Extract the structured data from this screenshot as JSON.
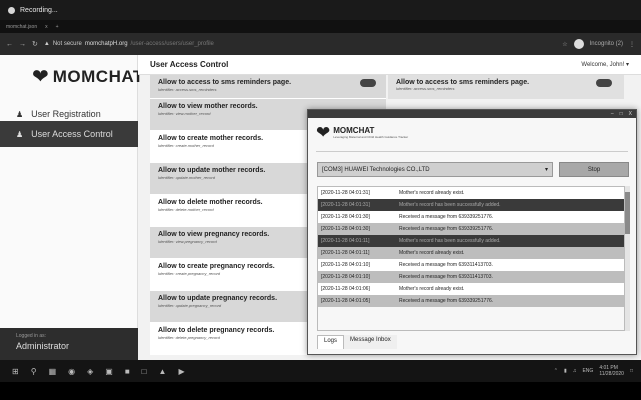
{
  "recording": {
    "label": "Recording..."
  },
  "browser": {
    "tab_labels": [
      "momchat.json",
      "x",
      "+"
    ],
    "security": "Not secure",
    "host": "momchatpH.org",
    "path": "/user-access/users/user_profile",
    "profile": "Incognito (2)"
  },
  "app": {
    "brand": "MOMCHAT",
    "sidebar": {
      "items": [
        {
          "label": "User Registration",
          "icon": "user-icon"
        },
        {
          "label": "User Access Control",
          "icon": "users-icon"
        }
      ],
      "footer_small": "Logged in as:",
      "footer_user": "Administrator"
    },
    "header": {
      "title": "User Access Control",
      "welcome": "Welcome, John! ▾"
    },
    "permissions": [
      {
        "label": "Allow to access to sms reminders page.",
        "ident": "Identifier: access.sms_reminders"
      },
      {
        "label": "Allow to view mother records.",
        "ident": "Identifier: view.mother_record"
      },
      {
        "label": "Allow to create mother records.",
        "ident": "Identifier: create.mother_record"
      },
      {
        "label": "Allow to update mother records.",
        "ident": "Identifier: update.mother_record"
      },
      {
        "label": "Allow to delete mother records.",
        "ident": "Identifier: delete.mother_record"
      },
      {
        "label": "Allow to view pregnancy records.",
        "ident": "Identifier: view.pregnancy_record"
      },
      {
        "label": "Allow to create pregnancy records.",
        "ident": "Identifier: create.pregnancy_record"
      },
      {
        "label": "Allow to update pregnancy records.",
        "ident": "Identifier: update.pregnancy_record"
      },
      {
        "label": "Allow to delete pregnancy records.",
        "ident": "Identifier: delete.pregnancy_record"
      }
    ],
    "permission_right": {
      "label": "Allow to access to sms reminders page.",
      "ident": "Identifier: access.sms_reminders"
    }
  },
  "dialog": {
    "titlebar_controls": [
      "–",
      "□",
      "X"
    ],
    "brand": "MOMCHAT",
    "tagline": "Leveraging Maternal and Child Health Guidance Tracker",
    "port": "[COM3] HUAWEI Technologies CO.,LTD",
    "stop_label": "Stop",
    "logs": [
      {
        "ts": "[2020-11-28 04:01:31]",
        "msg": "Mother's record already exist.",
        "style": "white"
      },
      {
        "ts": "[2020-11-28 04:01:31]",
        "msg": "Mother's record has been successfully added.",
        "style": "dark"
      },
      {
        "ts": "[2020-11-28 04:01:30]",
        "msg": "Received a message from 639339251776.",
        "style": "white"
      },
      {
        "ts": "[2020-11-28 04:01:30]",
        "msg": "Received a message from 639339251776.",
        "style": "gray"
      },
      {
        "ts": "[2020-11-28 04:01:11]",
        "msg": "Mother's record has been successfully added.",
        "style": "dark"
      },
      {
        "ts": "[2020-11-28 04:01:11]",
        "msg": "Mother's record already exist.",
        "style": "gray"
      },
      {
        "ts": "[2020-11-28 04:01:10]",
        "msg": "Received a message from 639311413703.",
        "style": "white"
      },
      {
        "ts": "[2020-11-28 04:01:10]",
        "msg": "Received a message from 639311413703.",
        "style": "gray"
      },
      {
        "ts": "[2020-11-28 04:01:06]",
        "msg": "Mother's record already exist.",
        "style": "white"
      },
      {
        "ts": "[2020-11-28 04:01:05]",
        "msg": "Received a message from 639339251776.",
        "style": "gray"
      }
    ],
    "tabs": [
      "Logs",
      "Message Inbox"
    ]
  },
  "taskbar": {
    "tray_lang": "ENG",
    "time": "4:01 PM",
    "date": "11/28/2020"
  }
}
